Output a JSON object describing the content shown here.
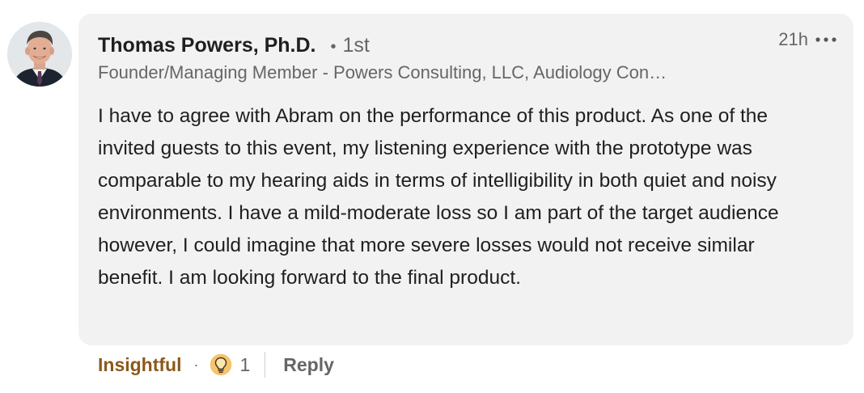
{
  "comment": {
    "author": {
      "name": "Thomas Powers, Ph.D.",
      "connection_degree": "1st",
      "headline": "Founder/Managing Member - Powers Consulting, LLC, Audiology Con…"
    },
    "timestamp": "21h",
    "body": "I have to agree with Abram on the performance of this product. As one of the invited guests to this event, my listening experience with the prototype was comparable to my hearing aids in terms of intelligibility in both quiet and noisy environments. I have a mild-moderate loss so I am part of the target audience however, I could imagine that more severe losses would not receive similar benefit. I am looking forward to the final product.",
    "actions": {
      "reaction_label": "Insightful",
      "separator": "·",
      "reaction_icon": "lightbulb-icon",
      "reaction_count": "1",
      "reply_label": "Reply"
    }
  },
  "colors": {
    "bubble_background": "#f2f2f2",
    "reaction_accent": "#8a5a1c",
    "muted_text": "#666666",
    "primary_text": "#1f1f1f"
  }
}
